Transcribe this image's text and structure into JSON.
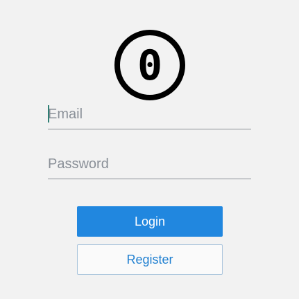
{
  "logo": {
    "glyph": "0",
    "icon": "zero-circle-logo",
    "color": "#000000"
  },
  "form": {
    "email": {
      "placeholder": "Email",
      "value": ""
    },
    "password": {
      "placeholder": "Password",
      "value": ""
    }
  },
  "buttons": {
    "login_label": "Login",
    "register_label": "Register"
  },
  "colors": {
    "accent": "#2187df",
    "background": "#f2f2f2",
    "caret": "#2f7f74"
  }
}
